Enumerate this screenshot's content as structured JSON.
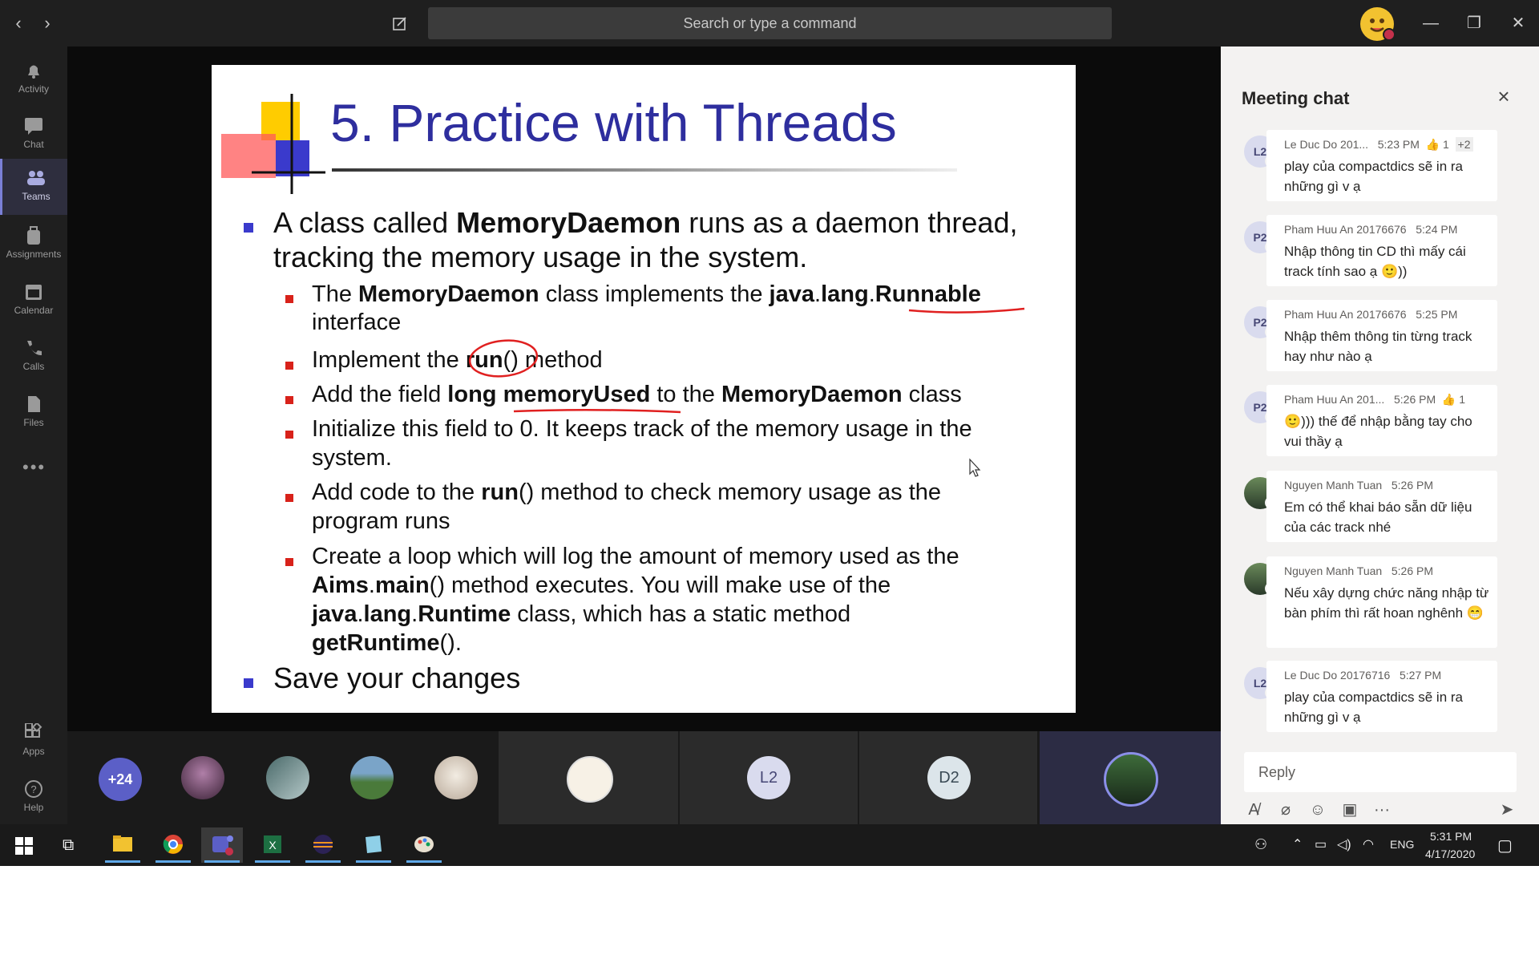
{
  "window": {
    "search_placeholder": "Search or type a command"
  },
  "rail": {
    "items": [
      {
        "label": "Activity",
        "icon": "bell-icon"
      },
      {
        "label": "Chat",
        "icon": "chat-icon"
      },
      {
        "label": "Teams",
        "icon": "teams-icon"
      },
      {
        "label": "Assignments",
        "icon": "backpack-icon"
      },
      {
        "label": "Calendar",
        "icon": "calendar-icon"
      },
      {
        "label": "Calls",
        "icon": "phone-icon"
      },
      {
        "label": "Files",
        "icon": "file-icon"
      }
    ],
    "apps_label": "Apps",
    "help_label": "Help"
  },
  "slide": {
    "title": "5. Practice with Threads",
    "bullets": {
      "b1_line1_pre": "A class called ",
      "b1_line1_bold": "MemoryDaemon",
      "b1_line1_post": " runs as a daemon thread,",
      "b1_line2": "tracking the memory usage in the system.",
      "s1_pre": "The ",
      "s1_bold1": "MemoryDaemon",
      "s1_mid": " class implements the ",
      "s1_bold2": "java",
      "s1_dot": ".",
      "s1_bold3": "lang",
      "s1_dot2": ".",
      "s1_bold4": "Runnable",
      "s1_line2": "interface",
      "s2_pre": "Implement the ",
      "s2_bold": "run",
      "s2_paren": "()",
      "s2_post": " method",
      "s3_pre": "Add the field ",
      "s3_bold1": "long",
      "s3_sp": " ",
      "s3_bold2": "memoryUsed",
      "s3_mid": " to the ",
      "s3_bold3": "MemoryDaemon",
      "s3_post": " class",
      "s4_line1": "Initialize this field to 0. It keeps track of the memory usage in the",
      "s4_line2": "system.",
      "s5_pre": "Add code to the ",
      "s5_bold": "run",
      "s5_post": "() method to check memory usage as the",
      "s5_line2": "program runs",
      "s6_line1": "Create a loop which will log the amount of memory used as the",
      "s6_bold1": "Aims",
      "s6_dot": ".",
      "s6_bold2": "main",
      "s6_post": "() method executes. You will make use of the",
      "s6_bold3": "java",
      "s6_dot2": ".",
      "s6_bold4": "lang",
      "s6_dot3": ".",
      "s6_bold5": "Runtime",
      "s6_post2": " class, which has a static method",
      "s6_bold6": "getRuntime",
      "s6_post3": "().",
      "b2": "Save your changes"
    }
  },
  "participants": {
    "overflow": "+24",
    "tiles": [
      {
        "initials": "L2"
      },
      {
        "initials": "D2"
      }
    ]
  },
  "chat": {
    "title": "Meeting chat",
    "messages": [
      {
        "initials": "L2",
        "name": "Le Duc Do 201...",
        "time": "5:23 PM",
        "reaction": "👍 1",
        "extra": "+2",
        "text": "play của compactdics sẽ in ra những gì v ạ",
        "status": "busy"
      },
      {
        "initials": "P2",
        "name": "Pham Huu An 20176676",
        "time": "5:24 PM",
        "reaction": "",
        "extra": "",
        "text": "Nhập thông tin CD thì mấy cái track tính sao ạ 🙂))",
        "status": "busy"
      },
      {
        "initials": "P2",
        "name": "Pham Huu An 20176676",
        "time": "5:25 PM",
        "reaction": "",
        "extra": "",
        "text": "Nhập thêm thông tin từng track hay như nào ạ",
        "status": "busy"
      },
      {
        "initials": "P2",
        "name": "Pham Huu An 201...",
        "time": "5:26 PM",
        "reaction": "👍 1",
        "extra": "",
        "text": "🙂))) thế để nhập bằng tay cho vui thầy ạ",
        "status": "busy"
      },
      {
        "initials": "",
        "name": "Nguyen Manh Tuan",
        "time": "5:26 PM",
        "reaction": "",
        "extra": "",
        "text": "Em có thể khai báo sẵn dữ liệu của các track nhé",
        "status": "away"
      },
      {
        "initials": "",
        "name": "Nguyen Manh Tuan",
        "time": "5:26 PM",
        "reaction": "",
        "extra": "",
        "text": "Nếu xây dựng chức năng nhập từ bàn phím thì rất hoan nghênh 😁",
        "status": "away"
      },
      {
        "initials": "L2",
        "name": "Le Duc Do 20176716",
        "time": "5:27 PM",
        "reaction": "",
        "extra": "",
        "text": "play của compactdics sẽ in ra những gì v ạ",
        "status": "busy"
      }
    ],
    "reply_placeholder": "Reply"
  },
  "taskbar": {
    "language": "ENG",
    "time": "5:31 PM",
    "date": "4/17/2020"
  },
  "colors": {
    "slide_title": "#2e2e9e",
    "accent": "#7a7fd6",
    "busy": "#c4314b",
    "away": "#f8d22a"
  }
}
